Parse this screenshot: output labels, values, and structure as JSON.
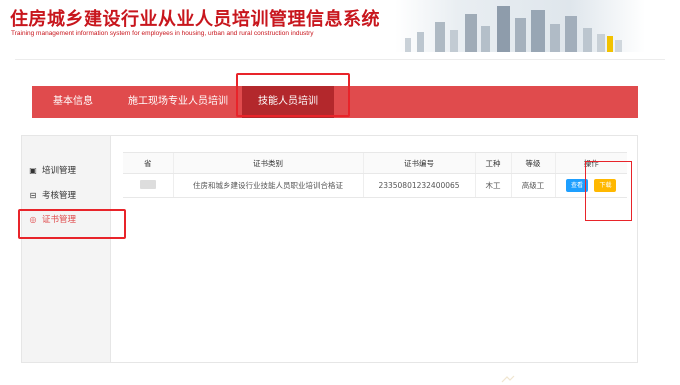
{
  "header": {
    "title": "住房城乡建设行业从业人员培训管理信息系统",
    "subtitle": "Training management information system for employees in housing, urban and rural construction industry"
  },
  "nav": {
    "items": [
      {
        "label": "基本信息"
      },
      {
        "label": "施工现场专业人员培训"
      },
      {
        "label": "技能人员培训"
      }
    ],
    "active_index": 2
  },
  "sidebar": {
    "items": [
      {
        "label": "培训管理",
        "icon": "training-icon"
      },
      {
        "label": "考核管理",
        "icon": "exam-icon"
      },
      {
        "label": "证书管理",
        "icon": "certificate-icon"
      }
    ],
    "active_index": 2
  },
  "table": {
    "headers": [
      "省",
      "证书类别",
      "证书编号",
      "工种",
      "等级",
      "操作"
    ],
    "rows": [
      {
        "province": "",
        "category": "住房和城乡建设行业技能人员职业培训合格证",
        "number": "23350801232400065",
        "trade": "木工",
        "level": "高级工",
        "view_label": "查看",
        "download_label": "下载"
      }
    ]
  },
  "colors": {
    "brand_red": "#c8161d",
    "nav_red": "#e04b4d",
    "nav_active": "#b3282c",
    "view_button": "#1e9fff",
    "download_button": "#ffb800",
    "annotation": "#e8242a"
  }
}
